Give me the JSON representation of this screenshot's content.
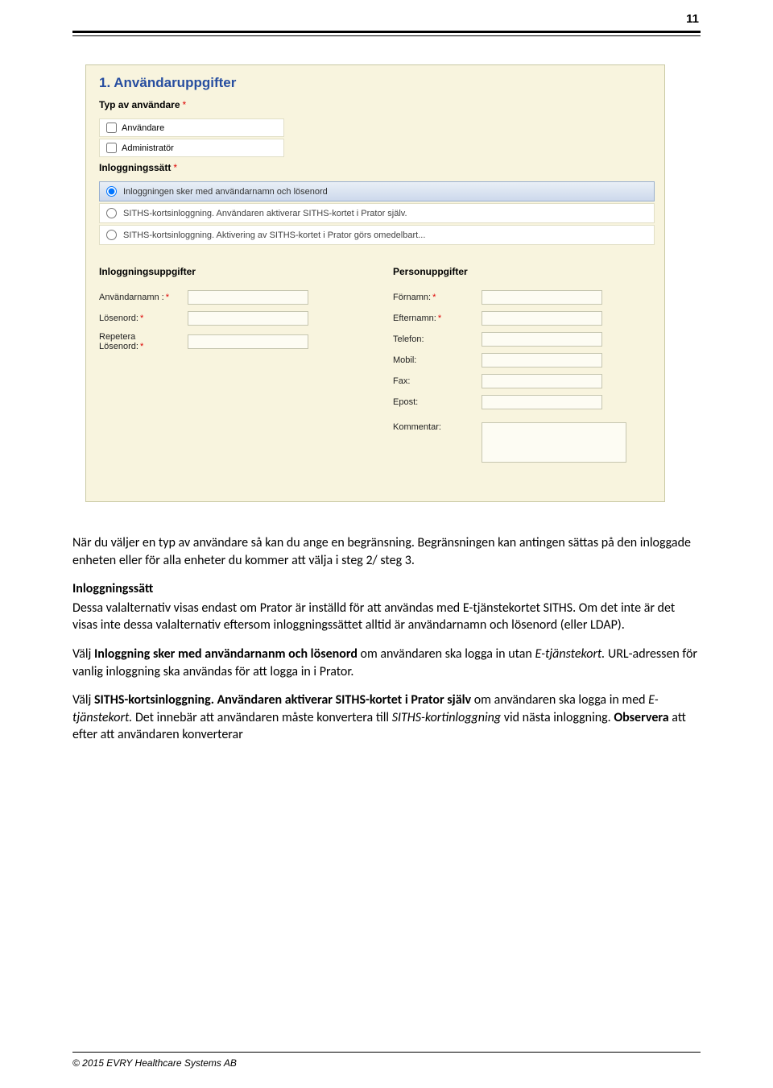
{
  "page": {
    "number": "11"
  },
  "form": {
    "heading": "1. Användaruppgifter",
    "section_user_type": {
      "title": "Typ av användare",
      "options": [
        "Användare",
        "Administratör"
      ]
    },
    "section_login_method": {
      "title": "Inloggningssätt",
      "options": [
        "Inloggningen sker med användarnamn och lösenord",
        "SITHS-kortsinloggning. Användaren aktiverar SITHS-kortet i Prator själv.",
        "SITHS-kortsinloggning. Aktivering av SITHS-kortet i Prator görs omedelbart..."
      ],
      "selected_index": 0
    },
    "login_details": {
      "title": "Inloggningsuppgifter",
      "username_label": "Användarnamn :",
      "password_label": "Lösenord:",
      "repeat_label_l1": "Repetera",
      "repeat_label_l2": "Lösenord:"
    },
    "person_details": {
      "title": "Personuppgifter",
      "firstname_label": "Förnamn:",
      "lastname_label": "Efternamn:",
      "phone_label": "Telefon:",
      "mobile_label": "Mobil:",
      "fax_label": "Fax:",
      "email_label": "Epost:",
      "comment_label": "Kommentar:"
    }
  },
  "body": {
    "p1": "När du väljer en typ av användare så kan du ange en begränsning. Begränsningen kan antingen sättas på den inloggade enheten eller för alla enheter du kommer att välja i steg 2/ steg 3.",
    "h_login": "Inloggningssätt",
    "p2": "Dessa valalternativ visas endast om Prator är inställd för att användas med E-tjänstekortet SITHS. Om det inte är det visas inte dessa valalternativ eftersom inloggningssättet alltid är användarnamn och lösenord (eller LDAP).",
    "p3a": "Välj ",
    "p3b": "Inloggning sker med användarnanm och lösenord",
    "p3c": " om användaren ska logga in utan ",
    "p3d": "E-tjänstekort.",
    "p3e": " URL-adressen för vanlig inloggning ska användas för att logga in i Prator.",
    "p4a": "Välj ",
    "p4b": "SITHS-kortsinloggning. Användaren aktiverar SITHS-kortet i Prator själv",
    "p4c": " om användaren ska logga in med ",
    "p4d": "E-tjänstekort.",
    "p4e": " Det innebär att användaren måste konvertera till ",
    "p4f": "SITHS-kortinloggning",
    "p4g": " vid nästa inloggning. ",
    "p4h": "Observera",
    "p4i": " att efter att användaren konverterar"
  },
  "footer": {
    "copyright": "© 2015 EVRY Healthcare Systems AB"
  }
}
